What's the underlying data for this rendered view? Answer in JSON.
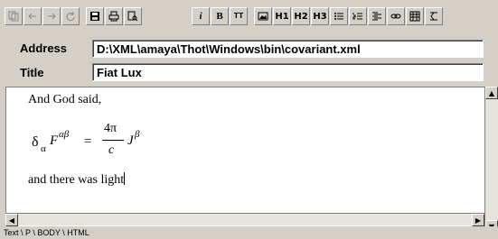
{
  "toolbar": {
    "buttons": [
      {
        "name": "copy-icon"
      },
      {
        "name": "back-icon"
      },
      {
        "name": "forward-icon"
      },
      {
        "name": "reload-icon"
      },
      {
        "name": "save-icon"
      },
      {
        "name": "print-icon"
      },
      {
        "name": "find-icon"
      },
      {
        "name": "italic-button",
        "label": "i"
      },
      {
        "name": "bold-button",
        "label": "B"
      },
      {
        "name": "typewriter-button",
        "label": "TT"
      },
      {
        "name": "image-icon"
      },
      {
        "name": "heading1-button",
        "label": "H1"
      },
      {
        "name": "heading2-button",
        "label": "H2"
      },
      {
        "name": "heading3-button",
        "label": "H3"
      },
      {
        "name": "bullet-list-icon"
      },
      {
        "name": "numbered-list-icon"
      },
      {
        "name": "definition-list-icon"
      },
      {
        "name": "link-icon"
      },
      {
        "name": "table-icon"
      },
      {
        "name": "math-icon"
      }
    ]
  },
  "address": {
    "label": "Address",
    "value": "D:\\XML\\amaya\\Thot\\Windows\\bin\\covariant.xml"
  },
  "title": {
    "label": "Title",
    "value": "Fiat Lux"
  },
  "document": {
    "line1": "And God said,",
    "math": {
      "delta": "δ",
      "sub": "α",
      "F": "F",
      "sup": "αβ",
      "eq": "=",
      "num": "4π",
      "den": "c",
      "J": "J",
      "jsup": "β"
    },
    "line2": "and there was light"
  },
  "status": {
    "path": "Text \\ P \\ BODY \\ HTML"
  }
}
